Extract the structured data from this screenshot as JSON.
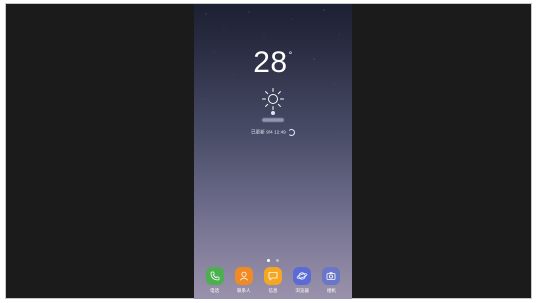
{
  "weather": {
    "temperature": "28",
    "degree_symbol": "°",
    "condition_icon": "sun-icon",
    "updated_text": "已更新 9/4 12:49"
  },
  "home": {
    "pages_total": 2,
    "current_page": 1
  },
  "dock": {
    "apps": [
      {
        "label": "电话",
        "icon": "phone-icon",
        "color": "#4caf50"
      },
      {
        "label": "联系人",
        "icon": "contacts-icon",
        "color": "#f08a24"
      },
      {
        "label": "信息",
        "icon": "messages-icon",
        "color": "#f5a623"
      },
      {
        "label": "浏览器",
        "icon": "browser-icon",
        "color": "#5b6bd6"
      },
      {
        "label": "相机",
        "icon": "camera-icon",
        "color": "#6a77c8"
      }
    ]
  }
}
